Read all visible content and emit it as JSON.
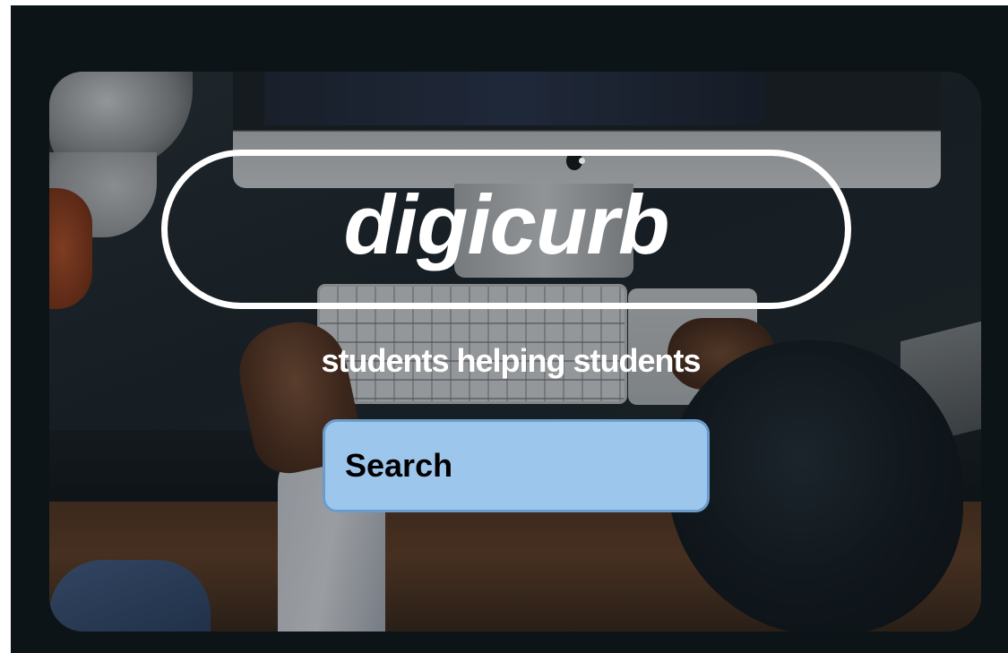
{
  "brand": {
    "logo_text": "digicurb",
    "tagline": "students helping students"
  },
  "search": {
    "placeholder": "Search",
    "value": ""
  },
  "colors": {
    "page_background": "#0d1418",
    "search_fill": "#9dc6ec",
    "search_border": "#6b9cc9",
    "logo_color": "#ffffff"
  },
  "hero_image": {
    "icon": "desk-workspace-photo"
  }
}
